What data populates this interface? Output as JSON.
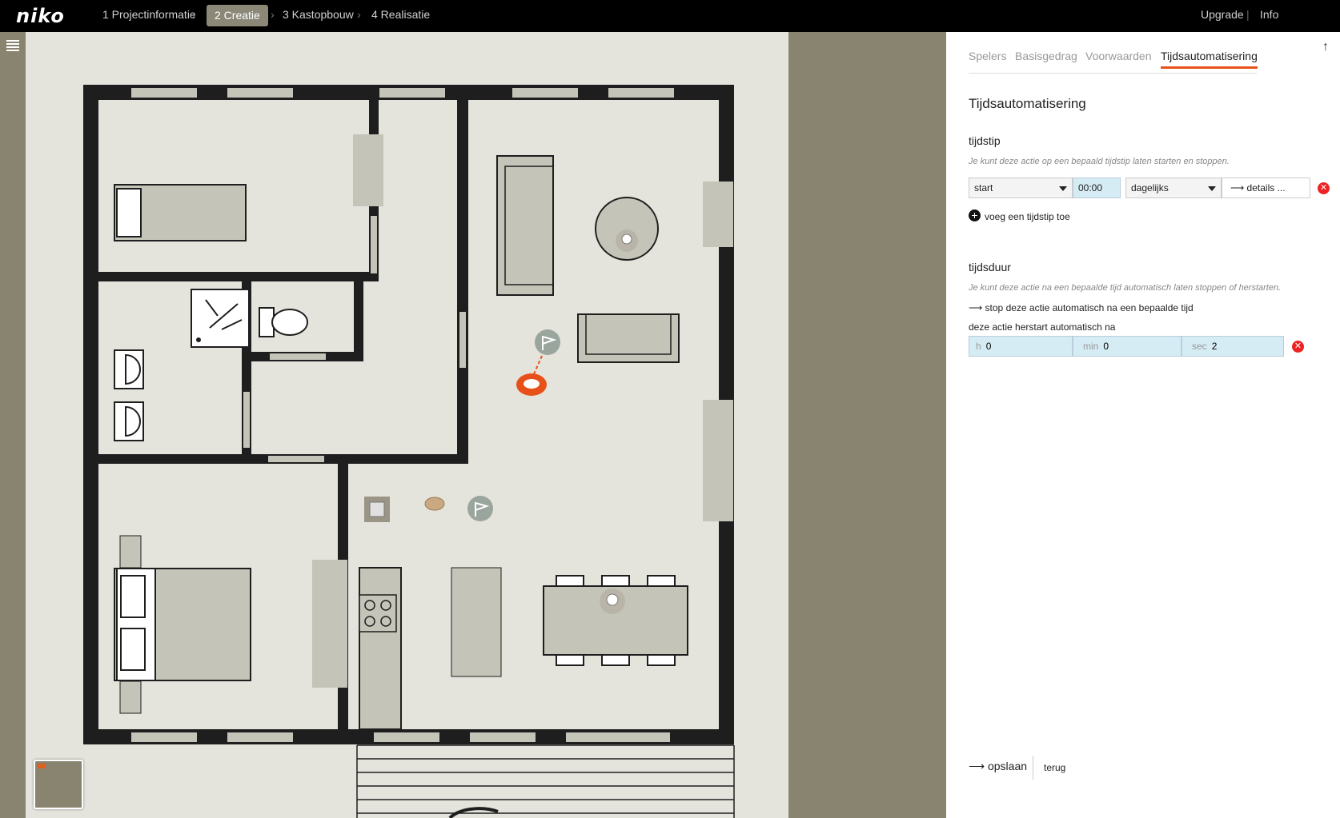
{
  "logo": "niko",
  "steps": [
    {
      "label": "1 Projectinformatie"
    },
    {
      "label": "2 Creatie"
    },
    {
      "label": "3 Kastopbouw"
    },
    {
      "label": "4 Realisatie"
    }
  ],
  "top_links": {
    "upgrade": "Upgrade",
    "separator": "|",
    "info": "Info"
  },
  "panel": {
    "tabs": [
      "Spelers",
      "Basisgedrag",
      "Voorwaarden",
      "Tijdsautomatisering"
    ],
    "title": "Tijdsautomatisering",
    "tijdstip": {
      "heading": "tijdstip",
      "hint": "Je kunt deze actie op een bepaald tijdstip laten starten en stoppen.",
      "mode": "start",
      "time": "00:00",
      "repeat": "dagelijks",
      "details": "details ...",
      "add_label": "voeg een tijdstip toe"
    },
    "tijdsduur": {
      "heading": "tijdsduur",
      "hint": "Je kunt deze actie na een bepaalde tijd automatisch laten stoppen of herstarten.",
      "stop_link": "stop deze actie automatisch na een bepaalde tijd",
      "restart_label": "deze actie herstart automatisch na",
      "h_label": "h",
      "h_value": "0",
      "min_label": "min",
      "min_value": "0",
      "sec_label": "sec",
      "sec_value": "2"
    },
    "save": "opslaan",
    "back": "terug"
  },
  "colors": {
    "accent": "#e8501a",
    "wall": "#1e1e1e",
    "floor": "#e4e4dd",
    "furniture": "#c4c4b8",
    "remove": "#e22222"
  }
}
